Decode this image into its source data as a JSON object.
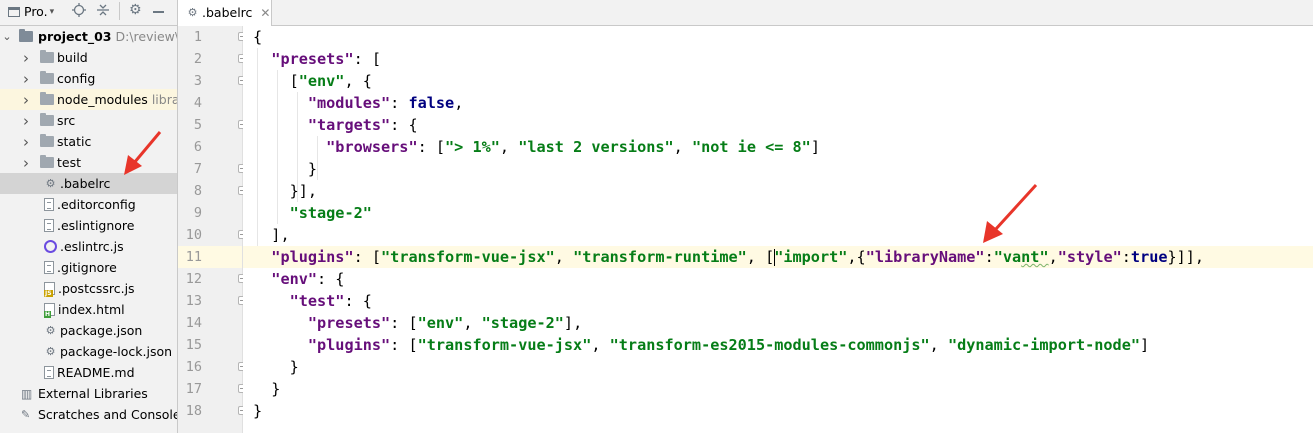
{
  "panel": {
    "title": "Pro.",
    "title_suffix": "▾",
    "header_icons": [
      "project-icon",
      "locate-icon",
      "collapse-icon",
      "gear-icon",
      "minimize-icon"
    ]
  },
  "tree": {
    "root": {
      "name": "project_03",
      "path": "D:\\review\\VU"
    },
    "items": [
      {
        "label": "build",
        "type": "folder"
      },
      {
        "label": "config",
        "type": "folder"
      },
      {
        "label": "node_modules",
        "type": "folder",
        "extra": "libra"
      },
      {
        "label": "src",
        "type": "folder"
      },
      {
        "label": "static",
        "type": "folder"
      },
      {
        "label": "test",
        "type": "folder"
      },
      {
        "label": ".babelrc",
        "type": "config-file"
      },
      {
        "label": ".editorconfig",
        "type": "file"
      },
      {
        "label": ".eslintignore",
        "type": "file"
      },
      {
        "label": ".eslintrc.js",
        "type": "eslint-file"
      },
      {
        "label": ".gitignore",
        "type": "file"
      },
      {
        "label": ".postcssrc.js",
        "type": "js-file"
      },
      {
        "label": "index.html",
        "type": "html-file"
      },
      {
        "label": "package.json",
        "type": "config-file"
      },
      {
        "label": "package-lock.json",
        "type": "config-file"
      },
      {
        "label": "README.md",
        "type": "file"
      }
    ],
    "external_libraries": "External Libraries",
    "scratches": "Scratches and Consoles"
  },
  "editor": {
    "tab_label": ".babelrc",
    "line_numbers": [
      "1",
      "2",
      "3",
      "4",
      "5",
      "6",
      "7",
      "8",
      "9",
      "10",
      "11",
      "12",
      "13",
      "14",
      "15",
      "16",
      "17",
      "18"
    ],
    "current_line": 11
  },
  "code": {
    "l1": "{",
    "l2_key": "\"presets\"",
    "l2_rest": ": [",
    "l3_open": "[",
    "l3_str": "\"env\"",
    "l3_rest": ", {",
    "l4_key": "\"modules\"",
    "l4_colon": ": ",
    "l4_val": "false",
    "l4_end": ",",
    "l5_key": "\"targets\"",
    "l5_rest": ": {",
    "l6_key": "\"browsers\"",
    "l6_a": ": [",
    "l6_s1": "\"> 1%\"",
    "l6_c1": ", ",
    "l6_s2": "\"last 2 versions\"",
    "l6_c2": ", ",
    "l6_s3": "\"not ie <= 8\"",
    "l6_end": "]",
    "l7": "}",
    "l8": "}],",
    "l9_str": "\"stage-2\"",
    "l10": "],",
    "l11_key": "\"plugins\"",
    "l11_a": ": [",
    "l11_s1": "\"transform-vue-jsx\"",
    "l11_c1": ", ",
    "l11_s2": "\"transform-runtime\"",
    "l11_c2": ", [",
    "l11_s3": "\"import\"",
    "l11_c3": ",{",
    "l11_k2": "\"libraryName\"",
    "l11_c4": ":",
    "l11_s4a": "\"va",
    "l11_s4b": "nt\"",
    "l11_c5": ",",
    "l11_k3": "\"style\"",
    "l11_c6": ":",
    "l11_v": "true",
    "l11_end": "}]],",
    "l12_key": "\"env\"",
    "l12_rest": ": {",
    "l13_key": "\"test\"",
    "l13_rest": ": {",
    "l14_key": "\"presets\"",
    "l14_a": ": [",
    "l14_s1": "\"env\"",
    "l14_c1": ", ",
    "l14_s2": "\"stage-2\"",
    "l14_end": "],",
    "l15_key": "\"plugins\"",
    "l15_a": ": [",
    "l15_s1": "\"transform-vue-jsx\"",
    "l15_c1": ", ",
    "l15_s2": "\"transform-es2015-modules-commonjs\"",
    "l15_c2": ", ",
    "l15_s3": "\"dynamic-import-node\"",
    "l15_end": "]",
    "l16": "}",
    "l17": "}",
    "l18": "}"
  },
  "colors": {
    "arrow": "#e8352a",
    "keyword": "#660e7a",
    "string": "#067d17",
    "literal": "#000080",
    "current_line": "#fffae3",
    "selected_row": "#d4d4d4"
  }
}
